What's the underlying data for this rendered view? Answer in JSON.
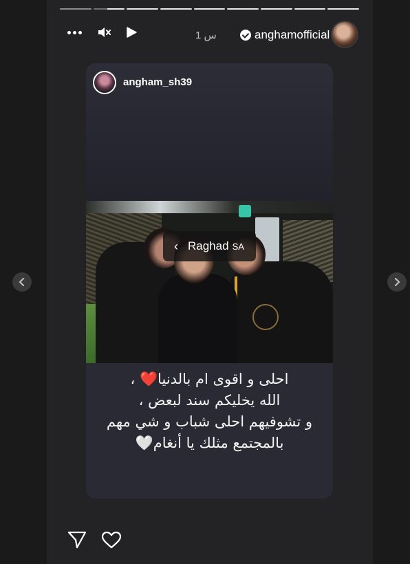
{
  "colors": {
    "page_background": "#1a1a1a",
    "story_background": "#232325",
    "card_background": "#2a2a34",
    "text": "#ffffff",
    "muted": "#bcbcbc"
  },
  "navigation": {
    "prev_icon": "chevron-left-icon",
    "next_icon": "chevron-right-icon"
  },
  "progress": {
    "segments": 9,
    "current_segment": 2,
    "current_fraction": 0.45
  },
  "header": {
    "controls": [
      "more-options-icon",
      "mute-icon",
      "play-icon"
    ],
    "time_ago": "1 س",
    "username": "anghamofficial",
    "verified": true
  },
  "shared_post": {
    "username": "angham_sh39",
    "mention": {
      "name": "Raghad",
      "suffix": "SA"
    },
    "caption_lines": [
      "احلى و اقوى ام بالدنيا❤️ ،",
      "الله يخليكم سند لبعض ،",
      "و تشوفيهم احلى شباب و شي مهم",
      "بالمجتمع مثلك يا أنغام🤍"
    ]
  },
  "footer": {
    "actions": [
      "send-icon",
      "heart-icon"
    ]
  }
}
